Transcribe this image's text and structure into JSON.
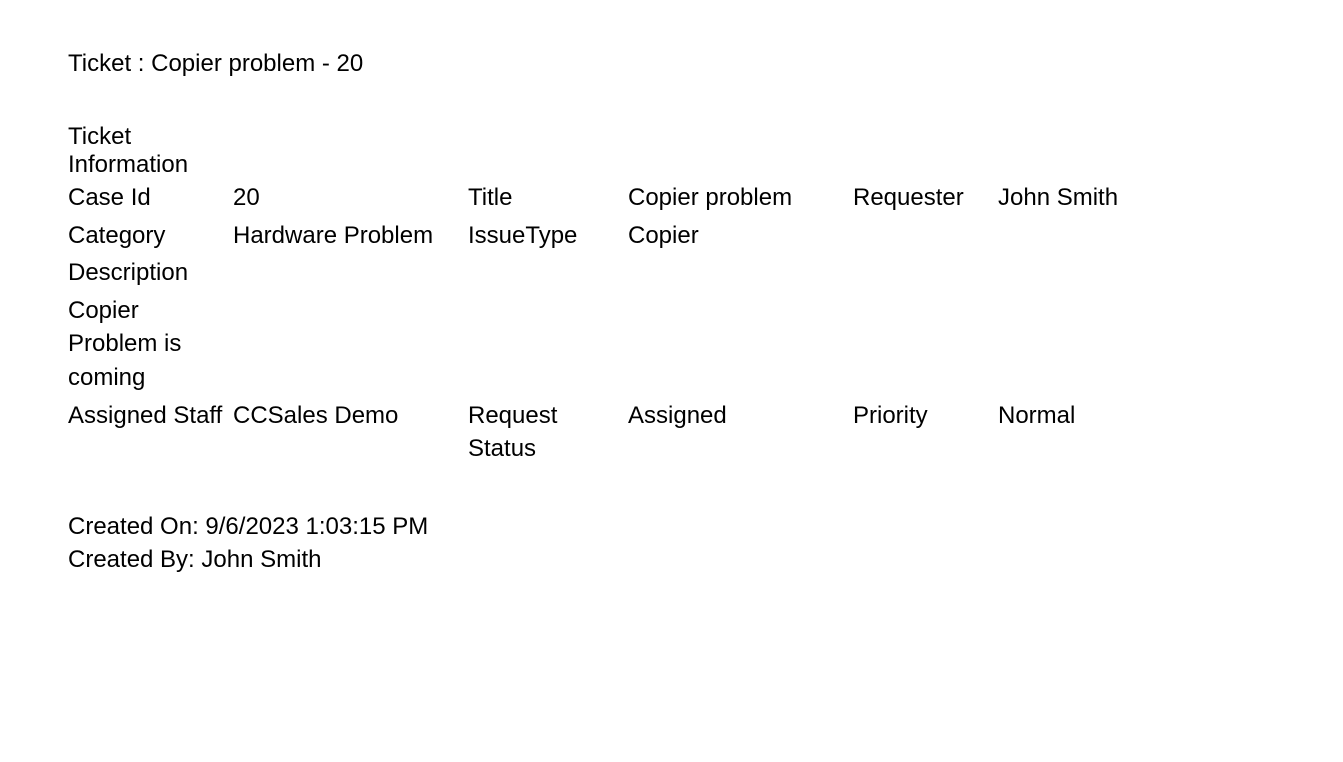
{
  "title": {
    "prefix": "Ticket : ",
    "text": "Copier problem - 20"
  },
  "section_heading_line1": "Ticket",
  "section_heading_line2": "Information",
  "fields": {
    "case_id": {
      "label": "Case Id",
      "value": "20"
    },
    "title": {
      "label": "Title",
      "value": "Copier problem"
    },
    "requester": {
      "label": "Requester",
      "value": "John Smith"
    },
    "category": {
      "label": "Category",
      "value": "Hardware Problem"
    },
    "issue_type": {
      "label": "IssueType",
      "value": "Copier"
    },
    "description": {
      "label": "Description",
      "value": "Copier Problem is coming"
    },
    "assigned_staff": {
      "label": "Assigned Staff",
      "value": "CCSales Demo"
    },
    "request_status": {
      "label": "Request Status",
      "value": "Assigned"
    },
    "priority": {
      "label": "Priority",
      "value": "Normal"
    }
  },
  "footer": {
    "created_on_label": "Created On: ",
    "created_on_value": "9/6/2023 1:03:15 PM",
    "created_by_label": "Created By: ",
    "created_by_value": "John Smith"
  }
}
